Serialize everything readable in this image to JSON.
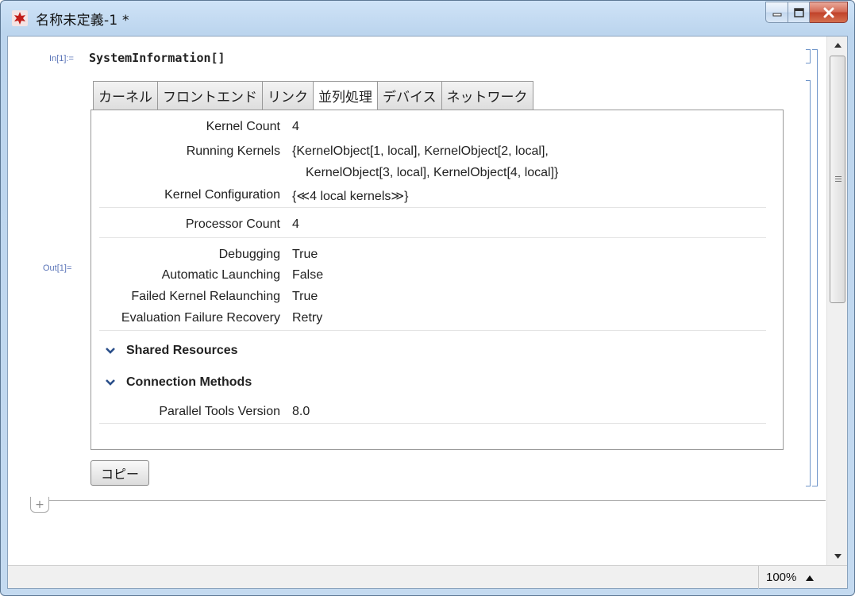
{
  "window": {
    "title": "名称未定義-1 *",
    "colors": {
      "frame": "#c4daf0",
      "close": "#c0412a",
      "cell_bracket": "#6f95c9",
      "label": "#5a74b8"
    }
  },
  "cell": {
    "in_label": "In[1]:=",
    "input_code": "SystemInformation[]",
    "out_label": "Out[1]="
  },
  "tabs": [
    {
      "label": "カーネル",
      "active": false
    },
    {
      "label": "フロントエンド",
      "active": false
    },
    {
      "label": "リンク",
      "active": false
    },
    {
      "label": "並列処理",
      "active": true
    },
    {
      "label": "デバイス",
      "active": false
    },
    {
      "label": "ネットワーク",
      "active": false
    }
  ],
  "parallel": {
    "kernel_count": {
      "key": "Kernel Count",
      "value": "4"
    },
    "running_kernels": {
      "key": "Running Kernels",
      "value_line1": "{KernelObject[1, local], KernelObject[2, local],",
      "value_line2": "KernelObject[3, local], KernelObject[4, local]}"
    },
    "kernel_configuration": {
      "key": "Kernel Configuration",
      "value": "{≪4 local kernels≫}"
    },
    "processor_count": {
      "key": "Processor Count",
      "value": "4"
    },
    "debugging": {
      "key": "Debugging",
      "value": "True"
    },
    "automatic_launching": {
      "key": "Automatic Launching",
      "value": "False"
    },
    "failed_kernel_relaunching": {
      "key": "Failed Kernel Relaunching",
      "value": "True"
    },
    "evaluation_failure_recovery": {
      "key": "Evaluation Failure Recovery",
      "value": "Retry"
    },
    "shared_resources": "Shared Resources",
    "connection_methods": "Connection Methods",
    "parallel_tools_version": {
      "key": "Parallel Tools Version",
      "value": "8.0"
    }
  },
  "copy_button": "コピー",
  "insert_cell": "+",
  "status": {
    "zoom": "100%"
  },
  "icons": {
    "app": "mathematica-star-icon",
    "minimize": "minimize-icon",
    "maximize": "maximize-icon",
    "close": "close-icon",
    "section_toggle": "chevron-down-icon",
    "scroll_up": "scroll-up-arrow-icon",
    "scroll_down": "scroll-down-arrow-icon",
    "zoom_menu": "triangle-up-icon"
  }
}
